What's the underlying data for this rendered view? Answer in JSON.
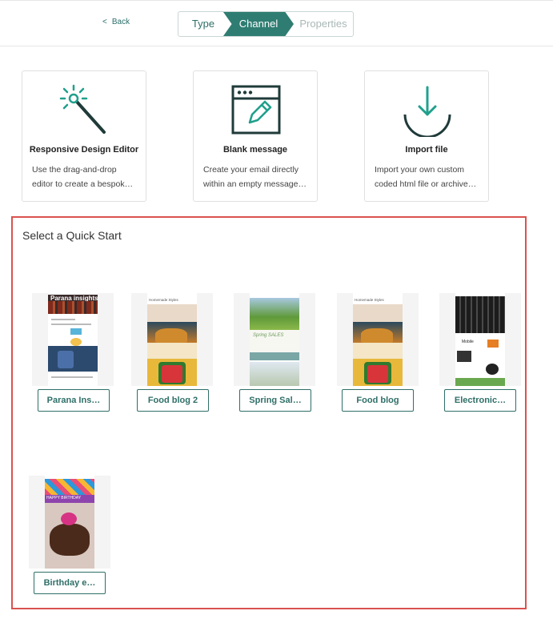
{
  "nav": {
    "back_label": "Back",
    "steps": [
      "Type",
      "Channel",
      "Properties"
    ]
  },
  "cards": [
    {
      "title": "Responsive Design Editor",
      "desc1": "Use the drag-and-drop",
      "desc2": "editor to create a bespok…",
      "icon": "magic-wand-icon"
    },
    {
      "title": "Blank message",
      "desc1": "Create your email directly",
      "desc2": "within an empty message…",
      "icon": "pencil-window-icon"
    },
    {
      "title": "Import file",
      "desc1": "Import your own custom",
      "desc2": "coded html file or archive…",
      "icon": "download-icon"
    }
  ],
  "quickstart": {
    "title": "Select a Quick Start",
    "templates": [
      {
        "label": "Parana Ins…",
        "thumb_header": "Parana insights"
      },
      {
        "label": "Food blog 2",
        "thumb_header": "Homemade Styles"
      },
      {
        "label": "Spring Sal…",
        "thumb_header": "Spring SALES"
      },
      {
        "label": "Food blog",
        "thumb_header": "Homemade Styles"
      },
      {
        "label": "Electronic…",
        "thumb_header": "Mobile"
      },
      {
        "label": "Birthday e…",
        "thumb_header": "HAPPY BIRTHDAY"
      }
    ]
  },
  "colors": {
    "accent": "#2f7d72",
    "highlight_border": "#d9534f"
  }
}
